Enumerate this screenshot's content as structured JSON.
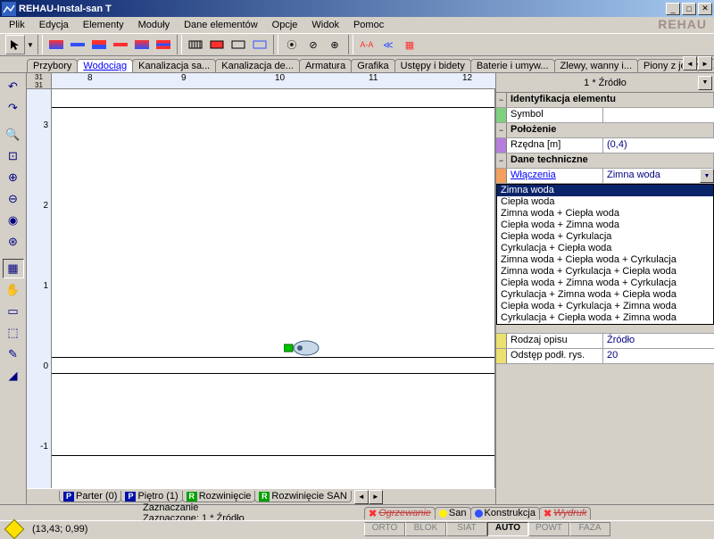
{
  "title": "REHAU-Instal-san T",
  "logo": "REHAU",
  "menu": [
    "Plik",
    "Edycja",
    "Elementy",
    "Moduły",
    "Dane elementów",
    "Opcje",
    "Widok",
    "Pomoc"
  ],
  "tabs": [
    "Przybory",
    "Wodociąg",
    "Kanalizacja sa...",
    "Kanalizacja de...",
    "Armatura",
    "Grafika",
    "Ustępy i bidety",
    "Baterie i umyw...",
    "Zlewy, wanny i...",
    "Piony z jednym..."
  ],
  "active_tab": 1,
  "ruler_top": [
    "8",
    "9",
    "10",
    "11",
    "12"
  ],
  "ruler_left": [
    "3",
    "2",
    "1",
    "0",
    "-1"
  ],
  "bottom_tabs": [
    {
      "badge": "P",
      "cls": "p",
      "label": "Parter (0)"
    },
    {
      "badge": "P",
      "cls": "p",
      "label": "Piętro (1)"
    },
    {
      "badge": "R",
      "cls": "r",
      "label": "Rozwinięcie"
    },
    {
      "badge": "R",
      "cls": "r",
      "label": "Rozwinięcie SAN"
    }
  ],
  "prop_title": "1 * Źródło",
  "sections": {
    "ident": {
      "title": "Identyfikacja elementu",
      "rows": [
        {
          "label": "Symbol",
          "value": ""
        }
      ]
    },
    "pos": {
      "title": "Położenie",
      "rows": [
        {
          "label": "Rzędna [m]",
          "value": "(0,4)"
        }
      ]
    },
    "tech": {
      "title": "Dane techniczne",
      "row": {
        "label": "Włączenia",
        "value": "Zimna woda"
      }
    },
    "extra": [
      {
        "label": "Rodzaj opisu",
        "value": "Źródło"
      },
      {
        "label": "Odstęp podł. rys.",
        "value": "20"
      }
    ]
  },
  "dropdown_options": [
    "Zimna woda",
    "Ciepła woda",
    "Zimna woda + Ciepła woda",
    "Ciepła woda + Zimna woda",
    "Ciepła woda + Cyrkulacja",
    "Cyrkulacja + Ciepła woda",
    "Zimna woda + Ciepła woda + Cyrkulacja",
    "Zimna woda + Cyrkulacja + Ciepła woda",
    "Ciepła woda + Zimna woda + Cyrkulacja",
    "Cyrkulacja + Zimna woda + Ciepła woda",
    "Ciepła woda + Cyrkulacja + Zimna woda",
    "Cyrkulacja + Ciepła woda + Zimna woda"
  ],
  "dropdown_selected": 0,
  "status1": {
    "center_a": "Zaznaczanie",
    "center_b": "Zaznaczone: 1 * Źródło"
  },
  "status_tabs": [
    {
      "icon": "x",
      "label": "Ogrzewanie",
      "strike": true
    },
    {
      "icon": "y",
      "label": "San"
    },
    {
      "icon": "b",
      "label": "Konstrukcja"
    },
    {
      "icon": "x",
      "label": "Wydruk",
      "strike": true
    }
  ],
  "coords": "(13,43; 0,99)",
  "modes": [
    "ORTO",
    "BLOK",
    "SIAT",
    "AUTO",
    "POWT",
    "FAZA"
  ],
  "mode_on": 3
}
